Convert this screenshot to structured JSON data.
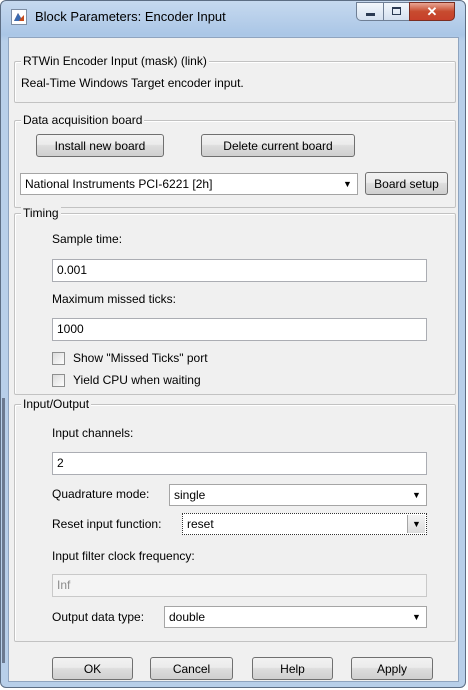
{
  "window": {
    "title": "Block Parameters: Encoder Input"
  },
  "mask": {
    "legend": "RTWin Encoder Input (mask) (link)",
    "description": "Real-Time Windows Target encoder input."
  },
  "daq": {
    "legend": "Data acquisition board",
    "install_label": "Install new board",
    "delete_label": "Delete current board",
    "board_selected": "National Instruments PCI-6221 [2h]",
    "setup_label": "Board setup"
  },
  "timing": {
    "legend": "Timing",
    "sample_time_label": "Sample time:",
    "sample_time_value": "0.001",
    "missed_ticks_label": "Maximum missed ticks:",
    "missed_ticks_value": "1000",
    "show_missed_label": "Show \"Missed Ticks\" port",
    "show_missed_checked": false,
    "yield_cpu_label": "Yield CPU when waiting",
    "yield_cpu_checked": false
  },
  "io": {
    "legend": "Input/Output",
    "channels_label": "Input channels:",
    "channels_value": "2",
    "quadrature_label": "Quadrature mode:",
    "quadrature_value": "single",
    "reset_label": "Reset input function:",
    "reset_value": "reset",
    "filter_label": "Input filter clock frequency:",
    "filter_value": "Inf",
    "output_type_label": "Output data type:",
    "output_type_value": "double"
  },
  "buttons": {
    "ok": "OK",
    "cancel": "Cancel",
    "help": "Help",
    "apply": "Apply"
  },
  "colors": {
    "titlebar": "#b8cfe9",
    "dialog_bg": "#f0f0f0",
    "close_button": "#c7402a"
  },
  "icons": {
    "app": "matlab-icon",
    "minimize": "minimize-icon",
    "maximize": "maximize-icon",
    "close": "close-icon",
    "dropdown": "chevron-down-icon"
  }
}
